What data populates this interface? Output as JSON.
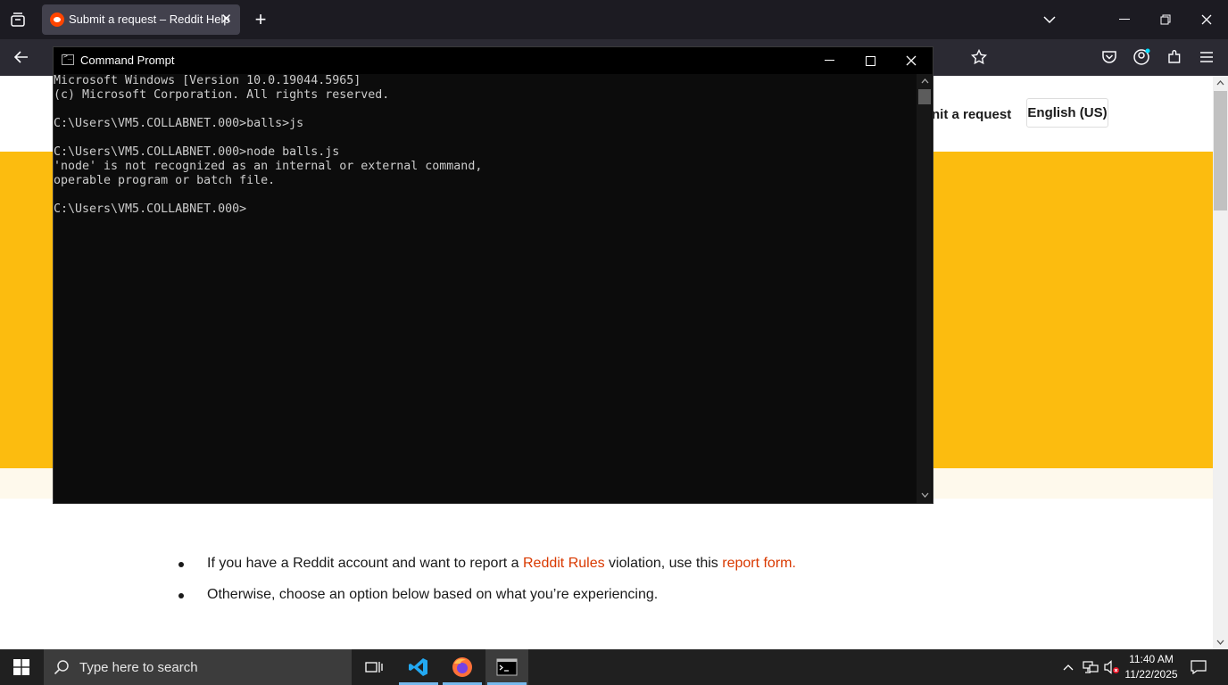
{
  "browser": {
    "tab_title": "Submit a request – Reddit Help",
    "tab_close": "✕",
    "new_tab": "+"
  },
  "page": {
    "header_link": "nit a request",
    "language_button": "English (US)",
    "bullets": [
      {
        "pre": "If you have a Reddit account and want to report a ",
        "link1": "Reddit Rules",
        "mid": " violation, use this ",
        "link2": "report form."
      },
      {
        "text": "Otherwise, choose an option below based on what you’re experiencing."
      }
    ]
  },
  "cmd": {
    "title": "Command Prompt",
    "output": "Microsoft Windows [Version 10.0.19044.5965]\n(c) Microsoft Corporation. All rights reserved.\n\nC:\\Users\\VM5.COLLABNET.000>balls>js\n\nC:\\Users\\VM5.COLLABNET.000>node balls.js\n'node' is not recognized as an internal or external command,\noperable program or batch file.\n\nC:\\Users\\VM5.COLLABNET.000>"
  },
  "taskbar": {
    "search_placeholder": "Type here to search",
    "time": "11:40 AM",
    "date": "11/22/2025"
  },
  "colors": {
    "hero_yellow": "#fcbc0f",
    "link_orange": "#d93900",
    "taskbar_bg": "#202020"
  }
}
